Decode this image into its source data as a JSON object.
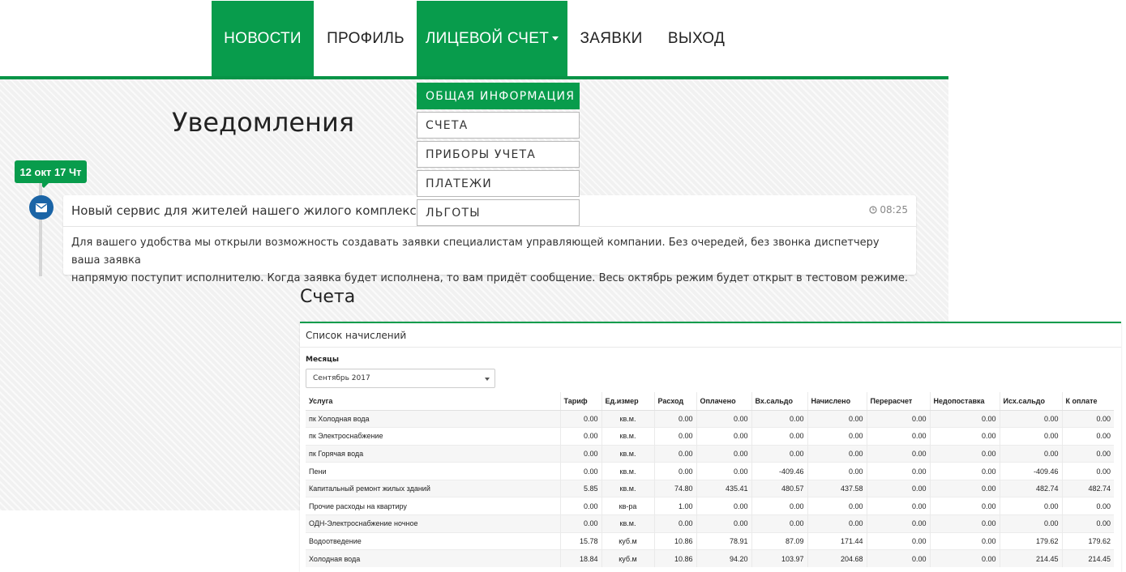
{
  "nav": {
    "items": [
      {
        "label": "НОВОСТИ"
      },
      {
        "label": "ПРОФИЛЬ"
      },
      {
        "label": "ЛИЦЕВОЙ СЧЕТ"
      },
      {
        "label": "ЗАЯВКИ"
      },
      {
        "label": "ВЫХОД"
      }
    ]
  },
  "dropdown": {
    "items": [
      {
        "label": "ОБЩАЯ ИНФОРМАЦИЯ"
      },
      {
        "label": "СЧЕТА"
      },
      {
        "label": "ПРИБОРЫ УЧЕТА"
      },
      {
        "label": "ПЛАТЕЖИ"
      },
      {
        "label": "ЛЬГОТЫ"
      }
    ]
  },
  "notifications": {
    "title": "Уведомления",
    "date_badge": "12 окт 17 Чт",
    "item": {
      "icon": "envelope-icon",
      "title": "Новый сервис для жителей нашего жилого комплекса",
      "time": "08:25",
      "body_line1": "Для вашего удобства мы открыли возможность создавать заявки специалистам управляющей компании. Без очередей, без звонка диспетчеру ваша заявка",
      "body_line2": "напрямую поступит исполнителю. Когда заявка будет исполнена, то вам придёт сообщение. Весь октябрь режим будет открыт в тестовом режиме."
    }
  },
  "accounts": {
    "title": "Счета",
    "panel_title": "Список начислений",
    "months_label": "Месяцы",
    "month_selected": "Сентябрь 2017",
    "columns": [
      "Услуга",
      "Тариф",
      "Ед.измер",
      "Расход",
      "Оплачено",
      "Вх.сальдо",
      "Начислено",
      "Перерасчет",
      "Недопоставка",
      "Исх.сальдо",
      "К оплате"
    ],
    "rows": [
      [
        "пк Холодная вода",
        "0.00",
        "кв.м.",
        "0.00",
        "0.00",
        "0.00",
        "0.00",
        "0.00",
        "0.00",
        "0.00",
        "0.00"
      ],
      [
        "пк Электроснабжение",
        "0.00",
        "кв.м.",
        "0.00",
        "0.00",
        "0.00",
        "0.00",
        "0.00",
        "0.00",
        "0.00",
        "0.00"
      ],
      [
        "пк Горячая вода",
        "0.00",
        "кв.м.",
        "0.00",
        "0.00",
        "0.00",
        "0.00",
        "0.00",
        "0.00",
        "0.00",
        "0.00"
      ],
      [
        "Пени",
        "0.00",
        "кв.м.",
        "0.00",
        "0.00",
        "-409.46",
        "0.00",
        "0.00",
        "0.00",
        "-409.46",
        "0.00"
      ],
      [
        "Капитальный ремонт жилых зданий",
        "5.85",
        "кв.м.",
        "74.80",
        "435.41",
        "480.57",
        "437.58",
        "0.00",
        "0.00",
        "482.74",
        "482.74"
      ],
      [
        "Прочие расходы на квартиру",
        "0.00",
        "кв-ра",
        "1.00",
        "0.00",
        "0.00",
        "0.00",
        "0.00",
        "0.00",
        "0.00",
        "0.00"
      ],
      [
        "ОДН-Электроснабжение ночное",
        "0.00",
        "кв.м.",
        "0.00",
        "0.00",
        "0.00",
        "0.00",
        "0.00",
        "0.00",
        "0.00",
        "0.00"
      ],
      [
        "Водоотведение",
        "15.78",
        "куб.м",
        "10.86",
        "78.91",
        "87.09",
        "171.44",
        "0.00",
        "0.00",
        "179.62",
        "179.62"
      ],
      [
        "Холодная вода",
        "18.84",
        "куб.м",
        "10.86",
        "94.20",
        "103.97",
        "204.68",
        "0.00",
        "0.00",
        "214.45",
        "214.45"
      ]
    ]
  },
  "colors": {
    "brand_green": "#089c4c",
    "envelope_blue": "#1a64a6"
  }
}
